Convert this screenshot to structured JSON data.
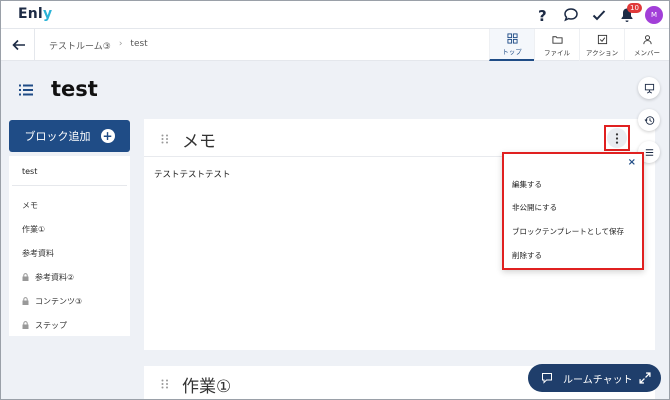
{
  "app": {
    "logo_main": "Enl",
    "logo_accent": "y"
  },
  "topbar": {
    "notification_count": "10",
    "avatar_initial": "M"
  },
  "navbar": {
    "breadcrumb": [
      "テストルーム③",
      "test"
    ],
    "tabs": [
      {
        "label": "トップ",
        "icon": "grid-icon",
        "active": true
      },
      {
        "label": "ファイル",
        "icon": "folder-icon",
        "active": false
      },
      {
        "label": "アクション",
        "icon": "checkbox-icon",
        "active": false
      },
      {
        "label": "メンバー",
        "icon": "person-icon",
        "active": false
      }
    ]
  },
  "page": {
    "title": "test"
  },
  "sidebar": {
    "add_block_label": "ブロック追加",
    "heading": "test",
    "items": [
      {
        "label": "メモ",
        "locked": false
      },
      {
        "label": "作業①",
        "locked": false
      },
      {
        "label": "参考資料",
        "locked": false
      },
      {
        "label": "参考資料②",
        "locked": true
      },
      {
        "label": "コンテンツ③",
        "locked": true
      },
      {
        "label": "ステップ",
        "locked": true
      }
    ]
  },
  "card": {
    "title": "メモ",
    "body": "テストテストテスト"
  },
  "dropdown": {
    "close": "×",
    "items": [
      "編集する",
      "非公開にする",
      "ブロックテンプレートとして保存",
      "削除する"
    ]
  },
  "card2": {
    "title": "作業①"
  },
  "chat": {
    "label": "ルームチャット"
  },
  "colors": {
    "primary": "#1f4c86",
    "highlight": "#e02020",
    "avatar": "#a23fd8"
  }
}
